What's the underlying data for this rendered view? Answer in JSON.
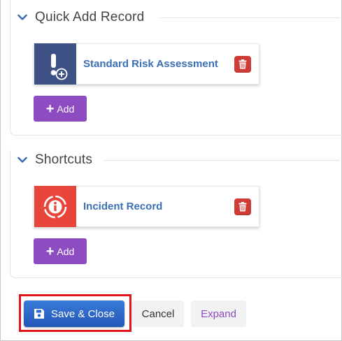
{
  "sections": [
    {
      "title": "Quick Add Record",
      "card": {
        "label": "Standard Risk Assessment",
        "icon": "risk-add-icon",
        "icon_color": "#3e5184"
      },
      "add_label": "Add"
    },
    {
      "title": "Shortcuts",
      "card": {
        "label": "Incident Record",
        "icon": "incident-icon",
        "icon_color": "#e8463b"
      },
      "add_label": "Add"
    }
  ],
  "footer": {
    "save_label": "Save & Close",
    "cancel_label": "Cancel",
    "expand_label": "Expand"
  },
  "colors": {
    "accent_purple": "#8e4cc2",
    "primary_blue": "#2d66c8",
    "link_blue": "#3b6fb5",
    "danger_red": "#cf3b35",
    "highlight_red": "#e0141d"
  }
}
